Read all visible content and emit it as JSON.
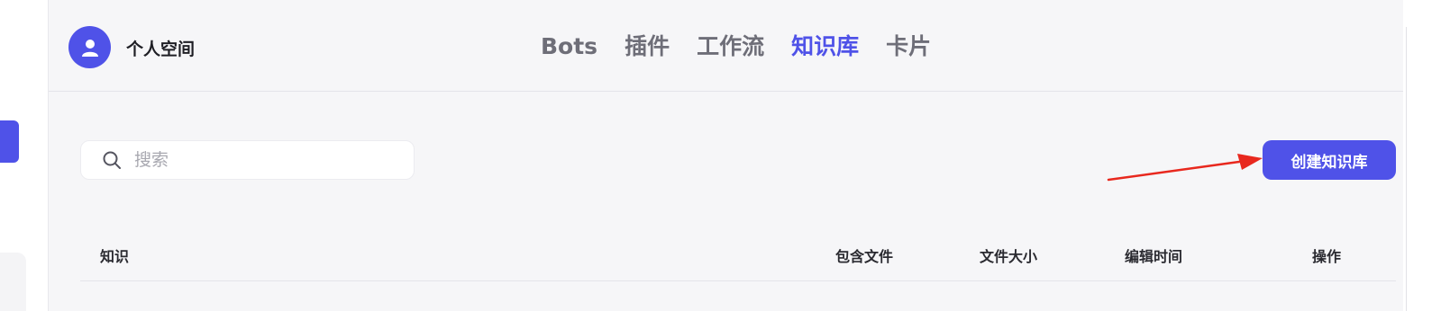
{
  "header": {
    "workspace_name": "个人空间",
    "tabs": [
      {
        "label": "Bots",
        "active": false
      },
      {
        "label": "插件",
        "active": false
      },
      {
        "label": "工作流",
        "active": false
      },
      {
        "label": "知识库",
        "active": true
      },
      {
        "label": "卡片",
        "active": false
      }
    ]
  },
  "search": {
    "placeholder": "搜索",
    "value": ""
  },
  "toolbar": {
    "create_label": "创建知识库"
  },
  "table": {
    "columns": [
      "知识",
      "包含文件",
      "文件大小",
      "编辑时间",
      "操作"
    ]
  },
  "colors": {
    "accent": "#4f52e8",
    "annotation_arrow": "#e8281e",
    "background": "#f6f6f8"
  },
  "icons": {
    "avatar": "user-icon",
    "search": "search-icon",
    "annotation": "arrow-icon"
  }
}
